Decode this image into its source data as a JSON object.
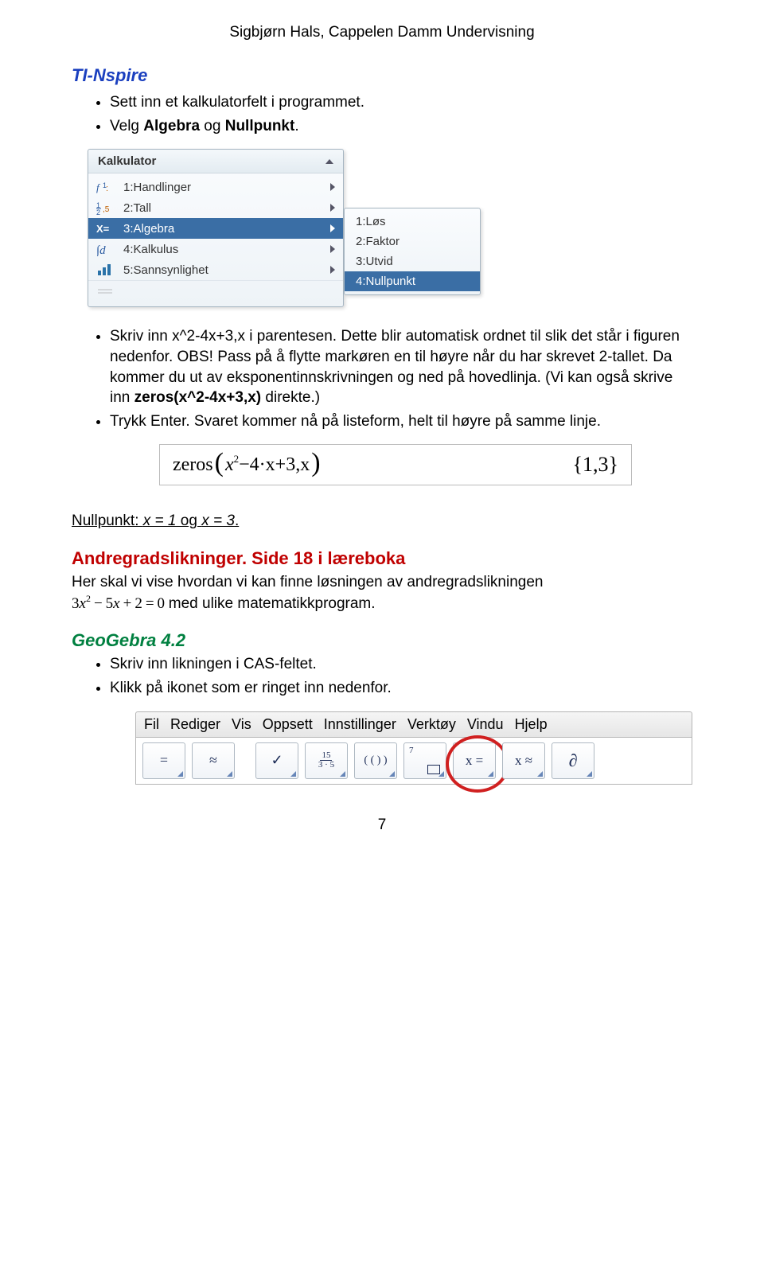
{
  "author_line": "Sigbjørn Hals, Cappelen Damm Undervisning",
  "section_ti": "TI-Nspire",
  "ti_bullets": {
    "b1_pre": "Sett inn et kalkulatorfelt i programmet.",
    "b2_pre": "Velg ",
    "b2_bold1": "Algebra",
    "b2_mid": " og ",
    "b2_bold2": "Nullpunkt",
    "b2_post": "."
  },
  "menu": {
    "title": "Kalkulator",
    "items": [
      {
        "label": "1:Handlinger"
      },
      {
        "label": "2:Tall"
      },
      {
        "label": "3:Algebra"
      },
      {
        "label": "4:Kalkulus"
      },
      {
        "label": "5:Sannsynlighet"
      }
    ],
    "sub": [
      {
        "label": "1:Løs"
      },
      {
        "label": "2:Faktor"
      },
      {
        "label": "3:Utvid"
      },
      {
        "label": "4:Nullpunkt"
      }
    ]
  },
  "ti_bullets2": {
    "b3_a": "Skriv inn x^2-4x+3,x i parentesen. Dette blir automatisk ordnet til slik det står i figuren nedenfor. OBS! Pass på å flytte markøren en til høyre når du har skrevet 2-tallet. Da kommer du ut av eksponentinnskrivningen og ned på hovedlinja. (Vi kan også skrive inn ",
    "b3_bold": "zeros(x^2-4x+3,x)",
    "b3_b": " direkte.)",
    "b4": "Trykk Enter. Svaret kommer nå på listeform, helt til høyre på samme linje."
  },
  "zeros": {
    "fn": "zeros",
    "expr_a": "x",
    "expr_sup": "2",
    "expr_b": "−4·x+3,x",
    "result": "1,3"
  },
  "nullpunkt_line": {
    "pre": "Nullpunkt: ",
    "eq1": "x = 1",
    "mid": " og ",
    "eq2": "x = 3",
    "post": "."
  },
  "andre": {
    "title": "Andregradslikninger. Side 18 i læreboka",
    "p1": "Her skal vi vise hvordan vi kan finne løsningen av andregradslikningen",
    "eq_a": "3",
    "eq_b": "x",
    "eq_sup": "2",
    "eq_c": "−",
    "eq_d": "5",
    "eq_e": "x",
    "eq_f": "+",
    "eq_g": "2",
    "eq_h": "=",
    "eq_i": "0",
    "p2": " med ulike matematikkprogram."
  },
  "geo": {
    "title": "GeoGebra 4.2",
    "b1": "Skriv inn likningen i CAS-feltet.",
    "b2": "Klikk på ikonet som er ringet inn nedenfor."
  },
  "gg_menu": [
    "Fil",
    "Rediger",
    "Vis",
    "Oppsett",
    "Innstillinger",
    "Verktøy",
    "Vindu",
    "Hjelp"
  ],
  "gg_buttons": {
    "eq": "=",
    "approx": "≈",
    "check": "✓",
    "frac_num": "15",
    "frac_den": "3 · 5",
    "paren": "( ( ) )",
    "seven": "7",
    "xeq": "x =",
    "xapprox": "x ≈",
    "partial": "∂"
  },
  "page_number": "7"
}
